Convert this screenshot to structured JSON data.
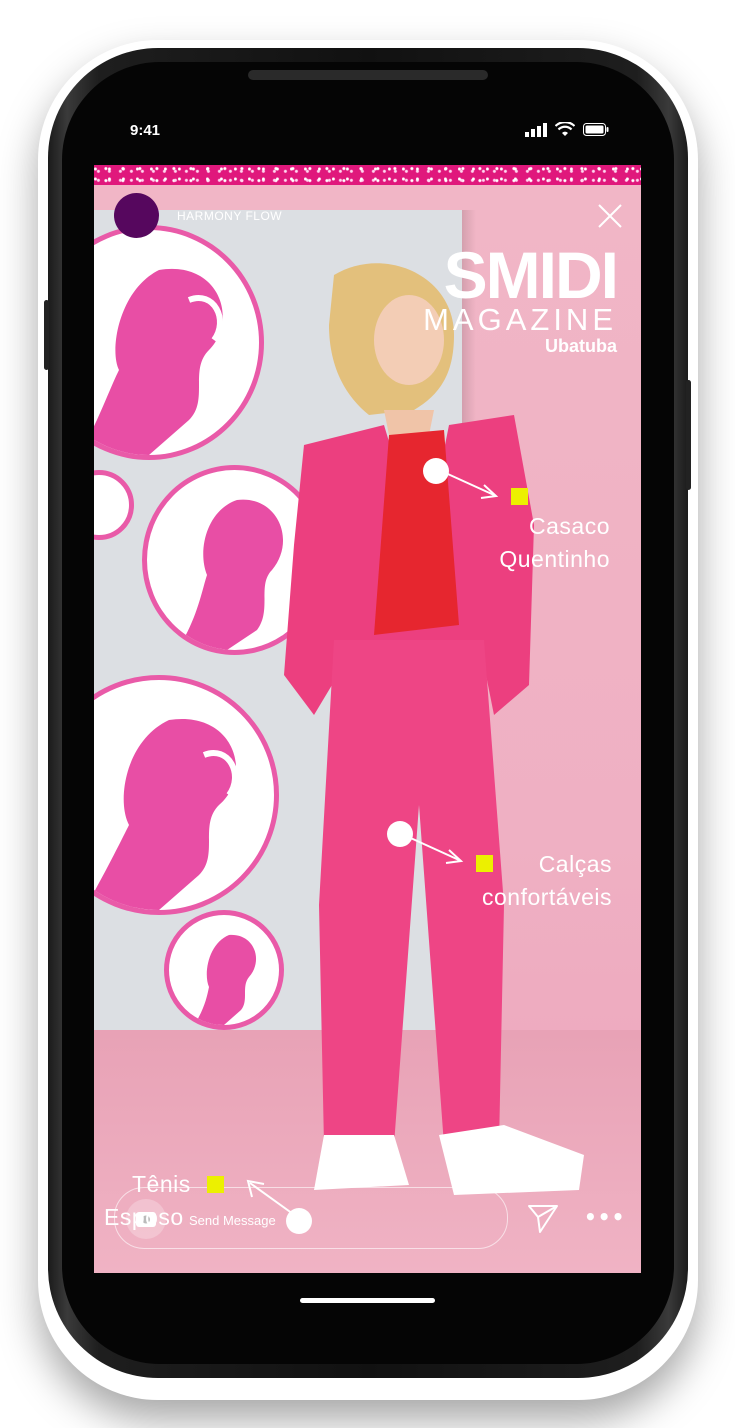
{
  "status_bar": {
    "time": "9:41"
  },
  "story": {
    "username": "HARMONY FLOW",
    "logo": {
      "brand": "SMIDI",
      "subtitle": "MAGAZINE",
      "city": "Ubatuba"
    },
    "tags": [
      {
        "label_line1": "Casaco",
        "label_line2": "Quentinho"
      },
      {
        "label_line1": "Calças",
        "label_line2": "confortáveis"
      },
      {
        "label_line1": "Tênis",
        "label_line2": "Esposo"
      }
    ],
    "message_placeholder": "Send Message",
    "more_label": "•••"
  },
  "colors": {
    "accent_pink": "#e8207d",
    "tag_square": "#ecf000",
    "avatar": "#56075e"
  }
}
